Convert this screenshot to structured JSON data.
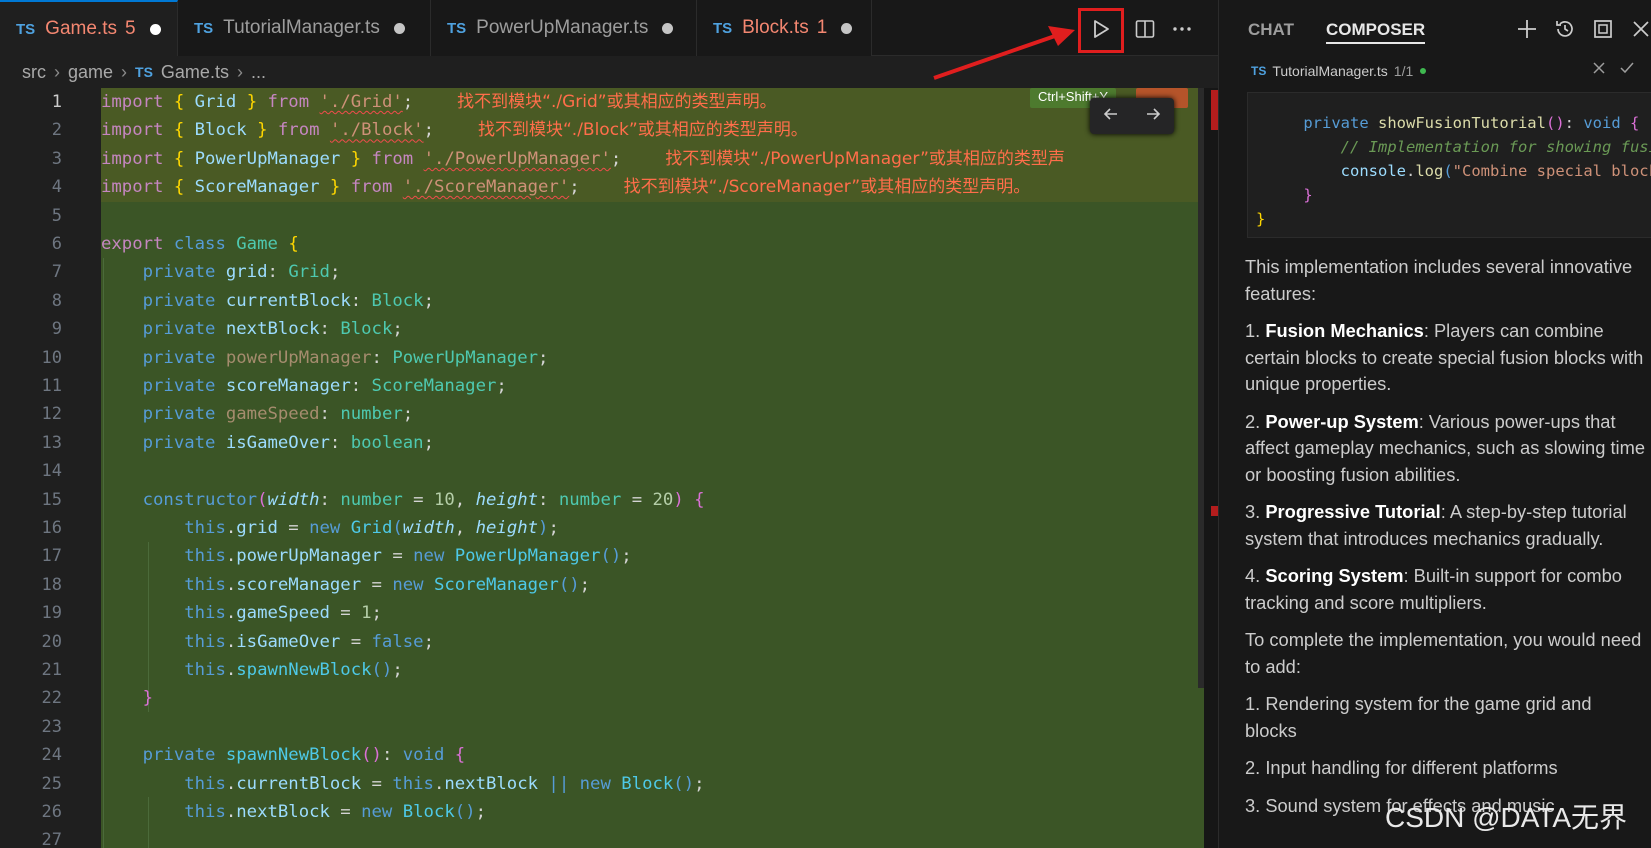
{
  "tabs": [
    {
      "icon": "TS",
      "label": "Game.ts",
      "count": "5",
      "has_error": true,
      "active": true
    },
    {
      "icon": "TS",
      "label": "TutorialManager.ts",
      "count": "",
      "has_error": false,
      "active": false
    },
    {
      "icon": "TS",
      "label": "PowerUpManager.ts",
      "count": "",
      "has_error": false,
      "active": false
    },
    {
      "icon": "TS",
      "label": "Block.ts",
      "count": "1",
      "has_error": true,
      "active": false
    }
  ],
  "breadcrumb": {
    "seg1": "src",
    "seg2": "game",
    "file_icon": "TS",
    "file": "Game.ts",
    "tail": "..."
  },
  "shortcut_hint": "Ctrl+Shift+Y",
  "icons": {
    "run": "play-icon",
    "split": "split-editor-icon",
    "more": "ellipsis-icon",
    "nav_prev": "arrow-left-icon",
    "nav_next": "arrow-right-icon",
    "new_chat": "plus-icon",
    "history": "history-icon",
    "maximize": "maximize-icon",
    "close": "close-icon",
    "reject": "close-icon",
    "accept": "check-icon"
  },
  "annotation_color": "#e01e1e",
  "line_numbers": [
    "1",
    "2",
    "3",
    "4",
    "5",
    "6",
    "7",
    "8",
    "9",
    "10",
    "11",
    "12",
    "13",
    "14",
    "15",
    "16",
    "17",
    "18",
    "19",
    "20",
    "21",
    "22",
    "23",
    "24",
    "25",
    "26",
    "27"
  ],
  "errors": {
    "e1": "找不到模块“./Grid”或其相应的类型声明。",
    "e2": "找不到模块“./Block”或其相应的类型声明。",
    "e3": "找不到模块“./PowerUpManager”或其相应的类型声",
    "e4": "找不到模块“./ScoreManager”或其相应的类型声明。"
  },
  "chat": {
    "tab_chat": "CHAT",
    "tab_composer": "COMPOSER",
    "file_icon": "TS",
    "file_name": "TutorialManager.ts",
    "file_frac": "1/1",
    "intro": "This implementation includes several innovative features:",
    "features": [
      {
        "num": "1.",
        "title": "Fusion Mechanics",
        "text": ": Players can combine certain blocks to create special fusion blocks with unique properties."
      },
      {
        "num": "2.",
        "title": "Power-up System",
        "text": ": Various power-ups that affect gameplay mechanics, such as slowing time or boosting fusion abilities."
      },
      {
        "num": "3.",
        "title": "Progressive Tutorial",
        "text": ": A step-by-step tutorial system that introduces mechanics gradually."
      },
      {
        "num": "4.",
        "title": "Scoring System",
        "text": ": Built-in support for combo tracking and score multipliers."
      }
    ],
    "todo_intro": "To complete the implementation, you would need to add:",
    "todos": [
      "1. Rendering system for the game grid and blocks",
      "2. Input handling for different platforms",
      "3. Sound system for effects and music"
    ]
  },
  "watermark": "CSDN @DATA无界"
}
